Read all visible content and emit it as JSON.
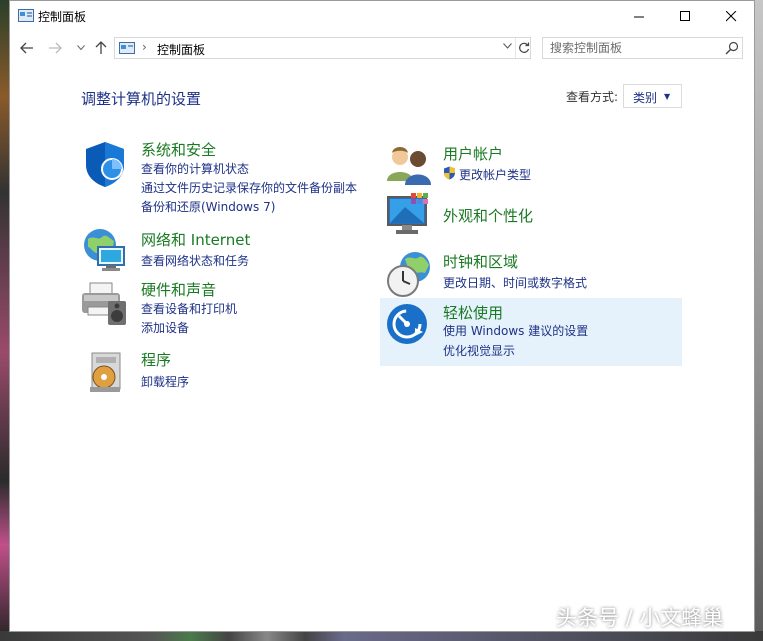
{
  "window": {
    "title": "控制面板"
  },
  "address": {
    "crumb": "控制面板",
    "search_placeholder": "搜索控制面板"
  },
  "header": {
    "title": "调整计算机的设置",
    "view_by_label": "查看方式:",
    "view_by_value": "类别"
  },
  "left_categories": [
    {
      "title": "系统和安全",
      "icon": "shield-icon",
      "links": [
        "查看你的计算机状态",
        "通过文件历史记录保存你的文件备份副本",
        "备份和还原(Windows 7)"
      ]
    },
    {
      "title": "网络和 Internet",
      "icon": "network-globe-icon",
      "links": [
        "查看网络状态和任务"
      ]
    },
    {
      "title": "硬件和声音",
      "icon": "printer-speaker-icon",
      "links": [
        "查看设备和打印机",
        "添加设备"
      ]
    },
    {
      "title": "程序",
      "icon": "programs-disc-icon",
      "links": [
        "卸载程序"
      ]
    }
  ],
  "right_categories": [
    {
      "title": "用户帐户",
      "icon": "users-icon",
      "links": [
        "更改帐户类型"
      ]
    },
    {
      "title": "外观和个性化",
      "icon": "monitor-palette-icon",
      "links": []
    },
    {
      "title": "时钟和区域",
      "icon": "clock-globe-icon",
      "links": [
        "更改日期、时间或数字格式"
      ]
    },
    {
      "title": "轻松使用",
      "icon": "ease-of-access-icon",
      "links": [
        "使用 Windows 建议的设置",
        "优化视觉显示"
      ]
    }
  ],
  "watermark": "头条号 / 小文蜂巢",
  "colors": {
    "link": "#1e3287",
    "category_title": "#1a7a23",
    "highlight": "#e5f1fb"
  }
}
